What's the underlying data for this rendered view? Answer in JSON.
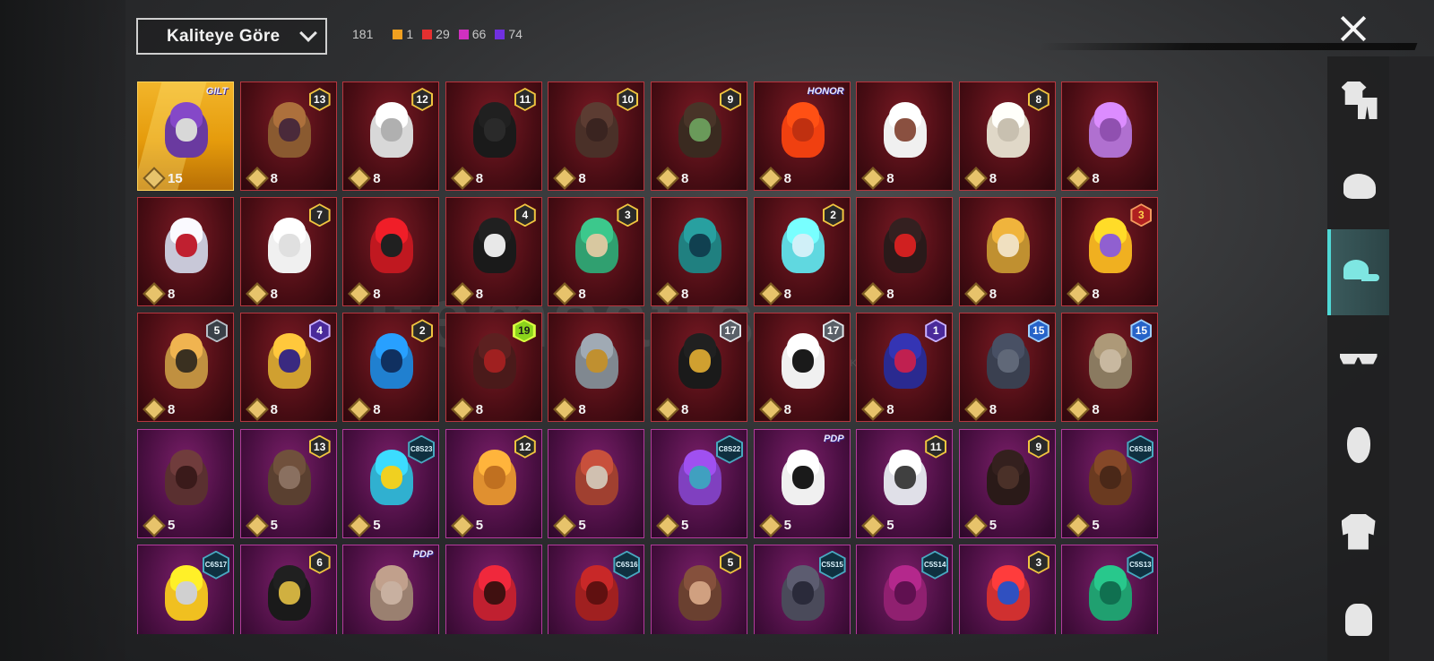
{
  "header": {
    "sort_label": "Kaliteye Göre",
    "total_count": "181",
    "rarity_counts": [
      {
        "value": "1",
        "color": "#f0a020"
      },
      {
        "value": "29",
        "color": "#e53030"
      },
      {
        "value": "66",
        "color": "#d030c0"
      },
      {
        "value": "74",
        "color": "#7030e0"
      }
    ]
  },
  "watermark": {
    "text": "itemsatis",
    "sub": "P / SKIN / ITEM / E-PIN"
  },
  "sidebar": {
    "items": [
      {
        "icon": "outfit-icon",
        "active": false
      },
      {
        "icon": "helmet-icon",
        "active": false
      },
      {
        "icon": "cap-icon",
        "active": true
      },
      {
        "icon": "glasses-icon",
        "active": false
      },
      {
        "icon": "mask-icon",
        "active": false
      },
      {
        "icon": "jacket-icon",
        "active": false
      },
      {
        "icon": "backpack-icon",
        "active": false
      }
    ]
  },
  "items": [
    {
      "rarity": "legendary",
      "cost": "15",
      "badge": "GILT",
      "badge_type": "brand",
      "hair": "#6a3aa0",
      "face": "#d8d8d8"
    },
    {
      "rarity": "mythic",
      "cost": "8",
      "badge": "13",
      "badge_type": "gold",
      "hair": "#8a5a30",
      "face": "#4a2a3a"
    },
    {
      "rarity": "mythic",
      "cost": "8",
      "badge": "12",
      "badge_type": "gold",
      "hair": "#d8d8d8",
      "face": "#b0b0b0"
    },
    {
      "rarity": "mythic",
      "cost": "8",
      "badge": "11",
      "badge_type": "gold",
      "hair": "#1a1a1a",
      "face": "#2a2a2a"
    },
    {
      "rarity": "mythic",
      "cost": "8",
      "badge": "10",
      "badge_type": "gold",
      "hair": "#4a3028",
      "face": "#3a2420"
    },
    {
      "rarity": "mythic",
      "cost": "8",
      "badge": "9",
      "badge_type": "gold",
      "hair": "#3a2a20",
      "face": "#6a9a5a"
    },
    {
      "rarity": "mythic",
      "cost": "8",
      "badge": "HONOR",
      "badge_type": "brand",
      "hair": "#f04010",
      "face": "#c03010"
    },
    {
      "rarity": "mythic",
      "cost": "8",
      "badge": "",
      "badge_type": "none",
      "hair": "#f0f0f0",
      "face": "#8a5040"
    },
    {
      "rarity": "mythic",
      "cost": "8",
      "badge": "8",
      "badge_type": "gold",
      "hair": "#e0d8c8",
      "face": "#c8c0b0"
    },
    {
      "rarity": "mythic",
      "cost": "8",
      "badge": "",
      "badge_type": "none",
      "hair": "#b070d0",
      "face": "#9050b0"
    },
    {
      "rarity": "mythic",
      "cost": "8",
      "badge": "",
      "badge_type": "none",
      "hair": "#c8c8d8",
      "face": "#c02030"
    },
    {
      "rarity": "mythic",
      "cost": "8",
      "badge": "7",
      "badge_type": "gold",
      "hair": "#f0f0f0",
      "face": "#e0e0e0"
    },
    {
      "rarity": "mythic",
      "cost": "8",
      "badge": "",
      "badge_type": "none",
      "hair": "#c01820",
      "face": "#202020"
    },
    {
      "rarity": "mythic",
      "cost": "8",
      "badge": "4",
      "badge_type": "gold",
      "hair": "#1a1a1a",
      "face": "#e8e8e8"
    },
    {
      "rarity": "mythic",
      "cost": "8",
      "badge": "3",
      "badge_type": "gold",
      "hair": "#30a070",
      "face": "#d8c8a0"
    },
    {
      "rarity": "mythic",
      "cost": "8",
      "badge": "",
      "badge_type": "none",
      "hair": "#208080",
      "face": "#104050"
    },
    {
      "rarity": "mythic",
      "cost": "8",
      "badge": "2",
      "badge_type": "gold",
      "hair": "#60d8e0",
      "face": "#d0f0f8"
    },
    {
      "rarity": "mythic",
      "cost": "8",
      "badge": "",
      "badge_type": "none",
      "hair": "#2a1a1a",
      "face": "#d02020"
    },
    {
      "rarity": "mythic",
      "cost": "8",
      "badge": "",
      "badge_type": "none",
      "hair": "#c09030",
      "face": "#f0e0c0"
    },
    {
      "rarity": "mythic",
      "cost": "8",
      "badge": "3",
      "badge_type": "red",
      "hair": "#f0b020",
      "face": "#9060d0"
    },
    {
      "rarity": "mythic",
      "cost": "8",
      "badge": "5",
      "badge_type": "silver",
      "hair": "#c09040",
      "face": "#3a3020"
    },
    {
      "rarity": "mythic",
      "cost": "8",
      "badge": "4",
      "badge_type": "purple",
      "hair": "#d0a030",
      "face": "#3a2a80"
    },
    {
      "rarity": "mythic",
      "cost": "8",
      "badge": "2",
      "badge_type": "gold",
      "hair": "#2080d0",
      "face": "#103060"
    },
    {
      "rarity": "mythic",
      "cost": "8",
      "badge": "19",
      "badge_type": "green",
      "hair": "#4a1a1a",
      "face": "#a02020"
    },
    {
      "rarity": "mythic",
      "cost": "8",
      "badge": "",
      "badge_type": "none",
      "hair": "#808890",
      "face": "#c09030"
    },
    {
      "rarity": "mythic",
      "cost": "8",
      "badge": "17",
      "badge_type": "steel",
      "hair": "#1a1a1a",
      "face": "#d0a030"
    },
    {
      "rarity": "mythic",
      "cost": "8",
      "badge": "17",
      "badge_type": "steel",
      "hair": "#f0f0f0",
      "face": "#1a1a1a"
    },
    {
      "rarity": "mythic",
      "cost": "8",
      "badge": "1",
      "badge_type": "purple",
      "hair": "#2a2a90",
      "face": "#c02050"
    },
    {
      "rarity": "mythic",
      "cost": "8",
      "badge": "15",
      "badge_type": "blue",
      "hair": "#3a4050",
      "face": "#606878"
    },
    {
      "rarity": "mythic",
      "cost": "8",
      "badge": "15",
      "badge_type": "blue",
      "hair": "#8a7a60",
      "face": "#c8b8a0"
    },
    {
      "rarity": "epic",
      "cost": "5",
      "badge": "",
      "badge_type": "none",
      "hair": "#5a3030",
      "face": "#3a1a1a"
    },
    {
      "rarity": "epic",
      "cost": "5",
      "badge": "13",
      "badge_type": "gold",
      "hair": "#5a4030",
      "face": "#8a7060"
    },
    {
      "rarity": "epic",
      "cost": "5",
      "badge": "C8S23",
      "badge_type": "season",
      "hair": "#30b0d0",
      "face": "#f0d020"
    },
    {
      "rarity": "epic",
      "cost": "5",
      "badge": "12",
      "badge_type": "gold",
      "hair": "#e09030",
      "face": "#c07020"
    },
    {
      "rarity": "epic",
      "cost": "5",
      "badge": "",
      "badge_type": "none",
      "hair": "#a04030",
      "face": "#d0c0b0"
    },
    {
      "rarity": "epic",
      "cost": "5",
      "badge": "C8S22",
      "badge_type": "season",
      "hair": "#8040c0",
      "face": "#40a0c0"
    },
    {
      "rarity": "epic",
      "cost": "5",
      "badge": "PDP",
      "badge_type": "brand",
      "hair": "#f0f0f0",
      "face": "#1a1a1a"
    },
    {
      "rarity": "epic",
      "cost": "5",
      "badge": "11",
      "badge_type": "gold",
      "hair": "#e0e0e8",
      "face": "#404040"
    },
    {
      "rarity": "epic",
      "cost": "5",
      "badge": "9",
      "badge_type": "gold",
      "hair": "#2a1a18",
      "face": "#4a3028"
    },
    {
      "rarity": "epic",
      "cost": "5",
      "badge": "C6S18",
      "badge_type": "season",
      "hair": "#6a3a20",
      "face": "#4a2818"
    },
    {
      "rarity": "epic",
      "cost": "",
      "badge": "C6S17",
      "badge_type": "season",
      "hair": "#f0c020",
      "face": "#d0d0d0"
    },
    {
      "rarity": "epic",
      "cost": "",
      "badge": "6",
      "badge_type": "gold",
      "hair": "#1a1a1a",
      "face": "#d0b040"
    },
    {
      "rarity": "epic",
      "cost": "",
      "badge": "PDP",
      "badge_type": "brand",
      "hair": "#9a8070",
      "face": "#c8b0a0"
    },
    {
      "rarity": "epic",
      "cost": "",
      "badge": "",
      "badge_type": "none",
      "hair": "#c02030",
      "face": "#401010"
    },
    {
      "rarity": "epic",
      "cost": "",
      "badge": "C6S16",
      "badge_type": "season",
      "hair": "#a02020",
      "face": "#601010"
    },
    {
      "rarity": "epic",
      "cost": "",
      "badge": "5",
      "badge_type": "gold",
      "hair": "#6a4030",
      "face": "#d0a080"
    },
    {
      "rarity": "epic",
      "cost": "",
      "badge": "C5S15",
      "badge_type": "season",
      "hair": "#4a4a5a",
      "face": "#2a2a3a"
    },
    {
      "rarity": "epic",
      "cost": "",
      "badge": "C5S14",
      "badge_type": "season",
      "hair": "#902070",
      "face": "#601050"
    },
    {
      "rarity": "epic",
      "cost": "",
      "badge": "3",
      "badge_type": "gold",
      "hair": "#d03030",
      "face": "#3050c0"
    },
    {
      "rarity": "epic",
      "cost": "",
      "badge": "C5S13",
      "badge_type": "season",
      "hair": "#20a070",
      "face": "#107050"
    }
  ]
}
